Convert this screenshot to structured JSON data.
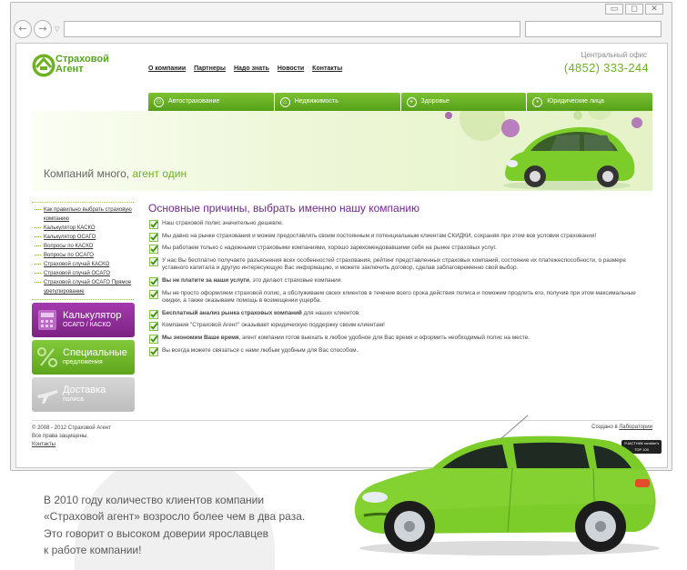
{
  "browser": {
    "window_controls": [
      "▭",
      "◻",
      "✕"
    ],
    "back_icon": "←",
    "forward_icon": "→",
    "dropdown_icon": "▽",
    "address_value": "",
    "search_value": ""
  },
  "site": {
    "logo_text_line1": "Страховой",
    "logo_text_line2": "Агент",
    "logo_letters": "СА",
    "nav": [
      "О компании",
      "Партнеры",
      "Надо знать",
      "Новости",
      "Контакты"
    ],
    "office_label": "Центральный офис",
    "office_phone": "(4852) 333-244",
    "tabs": [
      {
        "label": "Автострахование",
        "icon": "car-icon"
      },
      {
        "label": "Недвижимость",
        "icon": "house-icon"
      },
      {
        "label": "Здоровье",
        "icon": "plus-icon"
      },
      {
        "label": "Юридические лица",
        "icon": "person-icon"
      }
    ],
    "banner_text_1": "Компаний много,",
    "banner_text_2": " агент один",
    "sidebar_links": [
      "Как правильно выбрать страховую компанию",
      "Калькулятор КАСКО",
      "Калькулятор ОСАГО",
      "Вопросы по КАСКО",
      "Вопросы по ОСАГО",
      "Страховой случай КАСКО",
      "Страховой случай ОСАГО",
      "Страховой случай ОСАГО Прямое урегулирование"
    ],
    "promos": [
      {
        "title": "Калькулятор",
        "subtitle": "ОСАГО / КАСКО",
        "color": "#8e2a96"
      },
      {
        "title": "Специальные",
        "subtitle": "предложения",
        "color": "#6db221"
      },
      {
        "title": "Доставка",
        "subtitle": "полиса",
        "color": "#c9c9c9"
      }
    ],
    "main_heading": "Основные причины, выбрать именно нашу компанию",
    "reasons": [
      {
        "bold": "",
        "text": "Наш страховой полис значительно дешевле."
      },
      {
        "bold": "",
        "text": "Мы давно на рынке страхования и можем предоставлять своим постоянным и потенциальным клиентам СКИДКИ, сохраняя при этом все условия страхования!"
      },
      {
        "bold": "",
        "text": "Мы работаем только с надежными страховыми компаниями, хорошо зарекомендовавшими себя на рынке страховых услуг."
      },
      {
        "bold": "",
        "text": "У нас Вы бесплатно получаете разъяснения всех особенностей страхования, рейтинг представленных страховых компаний, состояние их платежеспособности, о размере уставного капитала и другую интересующую Вас информацию, и можете заключить договор, сделав заблаговременно свой выбор."
      },
      {
        "bold": "Вы не платите за наши услуги",
        "text": ", это делают страховые компании."
      },
      {
        "bold": "",
        "text": "Мы не просто оформляем страховой полис, а обслуживаем своих клиентов в течение всего срока действия полиса и поможем продлить его, получив при этом максимальные скидки, а также оказываем помощь в возмещении ущерба."
      },
      {
        "bold": "Бесплатный анализ рынка страховых компаний",
        "text": " для наших клиентов."
      },
      {
        "bold": "",
        "text": "Компания \"Страховой Агент\" оказывает юридическую поддержку своим клиентам!"
      },
      {
        "bold": "Мы экономим Ваше время",
        "text": ", агент компании готов выехать в любое удобное для Вас время и оформить необходимый полис на месте."
      },
      {
        "bold": "",
        "text": "Вы всегда можете связаться с нами любым удобным для Вас способом."
      }
    ],
    "footer_copyright": "© 2008 - 2012 Страховой Агент",
    "footer_rights": "Все права защищены.",
    "footer_contacts": "Контакты",
    "footer_created_prefix": "Создано в ",
    "footer_created_link": "Лаборатории",
    "badge_text": "УЧАСТНИК rambler's TOP 100"
  },
  "caption": [
    "В 2010 году количество клиентов компании",
    "«Страховой агент» возросло более чем в два раза.",
    "Это говорит о высоком доверии ярославцев",
    "к работе компании!"
  ],
  "colors": {
    "green": "#6db221",
    "purple": "#6e2b8a",
    "car_green": "#7ccc2a"
  }
}
